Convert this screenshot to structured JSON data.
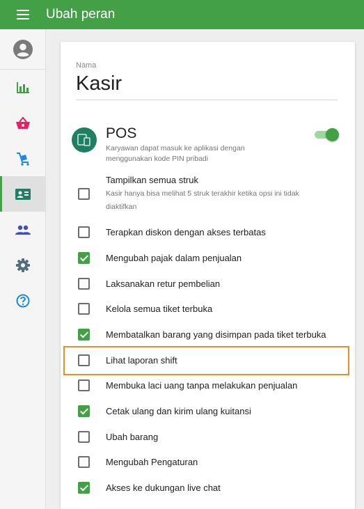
{
  "appbar": {
    "title": "Ubah peran",
    "menu_icon": "menu-icon"
  },
  "sidebar": {
    "avatar_icon": "account-circle-icon",
    "items": [
      {
        "id": "reports",
        "icon": "bar-chart-icon",
        "color": "#43a047"
      },
      {
        "id": "items",
        "icon": "basket-icon",
        "color": "#e91e63"
      },
      {
        "id": "inventory",
        "icon": "cart-icon",
        "color": "#1e88e5"
      },
      {
        "id": "employees",
        "icon": "id-card-icon",
        "color": "#1e7f63",
        "active": true
      },
      {
        "id": "customers",
        "icon": "people-icon",
        "color": "#3f51b5"
      },
      {
        "id": "settings",
        "icon": "gear-icon",
        "color": "#546e7a"
      },
      {
        "id": "help",
        "icon": "help-circle-icon",
        "color": "#1e88e5"
      }
    ]
  },
  "form": {
    "name_label": "Nama",
    "name_value": "Kasir",
    "pos": {
      "title": "POS",
      "description": "Karyawan dapat masuk ke aplikasi dengan menggunakan kode PIN pribadi",
      "enabled": true
    },
    "permissions": [
      {
        "label": "Tampilkan semua struk",
        "sub": "Kasir hanya bisa melihat 5 struk terakhir ketika opsi ini tidak diaktifkan",
        "checked": false
      },
      {
        "label": "Terapkan diskon dengan akses terbatas",
        "checked": false
      },
      {
        "label": "Mengubah pajak dalam penjualan",
        "checked": true
      },
      {
        "label": "Laksanakan retur pembelian",
        "checked": false
      },
      {
        "label": "Kelola semua tiket terbuka",
        "checked": false
      },
      {
        "label": "Membatalkan barang yang disimpan pada tiket terbuka",
        "checked": true
      },
      {
        "label": "Lihat laporan shift",
        "checked": false,
        "highlighted": true
      },
      {
        "label": "Membuka laci uang tanpa melakukan penjualan",
        "checked": false
      },
      {
        "label": "Cetak ulang dan kirim ulang kuitansi",
        "checked": true
      },
      {
        "label": "Ubah barang",
        "checked": false
      },
      {
        "label": "Mengubah Pengaturan",
        "checked": false
      },
      {
        "label": "Akses ke dukungan live chat",
        "checked": true
      }
    ]
  },
  "colors": {
    "primary": "#43a047",
    "highlight": "#f08a24"
  }
}
